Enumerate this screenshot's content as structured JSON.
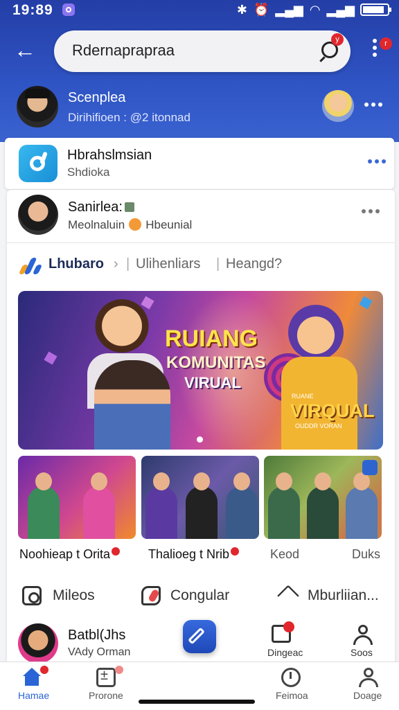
{
  "status_bar": {
    "time": "19:89"
  },
  "search": {
    "value": "Rdernaprapraa",
    "badge": "y"
  },
  "header_menu": {
    "badge": "r"
  },
  "user1": {
    "name": "Scenplea",
    "subtitle": "Dirihifioen : @2 itonnad"
  },
  "app_card": {
    "title": "Hbrahslmsian",
    "subtitle": "Shdioka"
  },
  "post": {
    "author": "Sanirlea:",
    "subtitle_left": "Meolnaluin",
    "subtitle_right": "Hbeunial"
  },
  "breadcrumb": {
    "brand": "Lhubaro",
    "sep": "|",
    "item2": "Ulihenliars",
    "item3": "Heangd?"
  },
  "hero": {
    "line1": "RUIANG",
    "line2": "KOMUNITAS",
    "line3": "VIRUAL",
    "line4": "VIRQUAL",
    "small1": "RUANE",
    "small2": "OUDDR VORAN"
  },
  "thumbs": [
    {
      "label": "Noohieap t Orita",
      "has_dot": true
    },
    {
      "label": "Thalioeg t Nrib",
      "has_dot": true
    },
    {
      "label": "Keod",
      "has_dot": false
    },
    {
      "label": "Duks",
      "has_dot": false
    }
  ],
  "actions": {
    "videos": "Mileos",
    "congular": "Congular",
    "more": "Mburliian..."
  },
  "user3": {
    "name": "Batbl(Jhs",
    "subtitle": "VAdy Orman"
  },
  "mini_actions": {
    "first": "Dingeac",
    "second": "Soos"
  },
  "bottom_nav": [
    {
      "label": "Hamae",
      "active": true
    },
    {
      "label": "Prorone",
      "active": false
    },
    {
      "label": "Feimoa",
      "active": false
    },
    {
      "label": "Doage",
      "active": false
    }
  ],
  "colors": {
    "header": "#2f54c4",
    "accent": "#2a64d6",
    "badge": "#e0272d"
  }
}
